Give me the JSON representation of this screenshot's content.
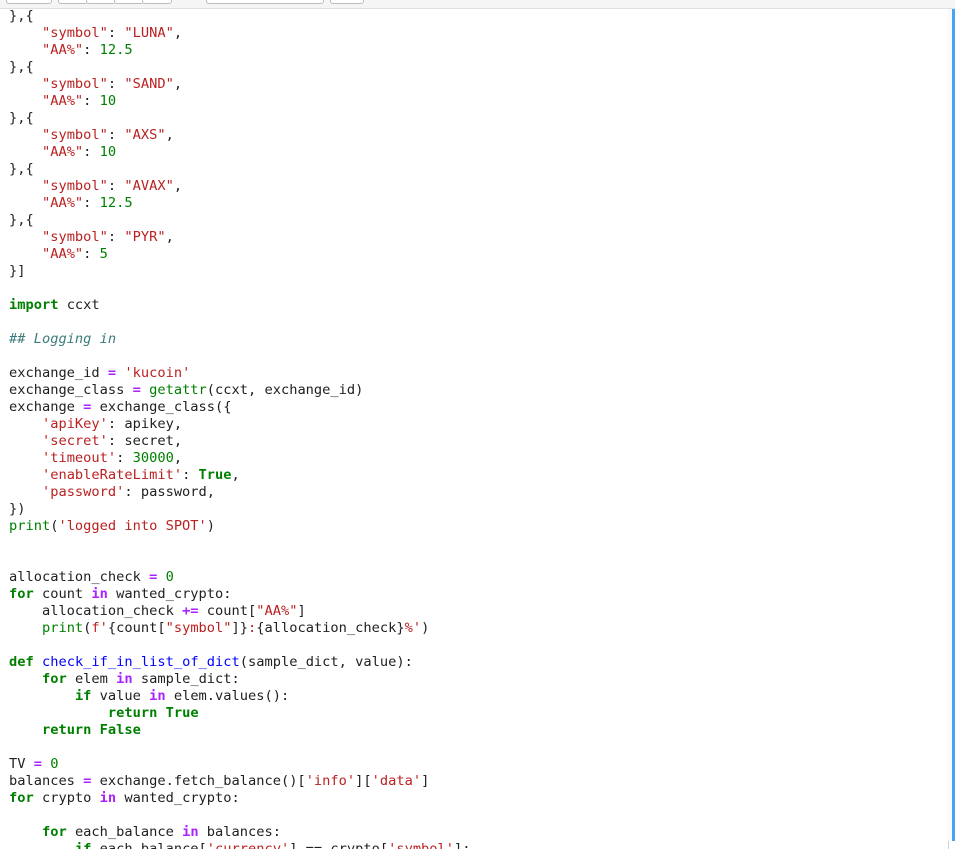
{
  "code_lines": [
    [
      [
        "},{",
        "pl"
      ]
    ],
    [
      [
        "    ",
        "pl"
      ],
      [
        "\"symbol\"",
        "st"
      ],
      [
        ": ",
        "pl"
      ],
      [
        "\"LUNA\"",
        "st"
      ],
      [
        ",",
        "pl"
      ]
    ],
    [
      [
        "    ",
        "pl"
      ],
      [
        "\"AA%\"",
        "st"
      ],
      [
        ": ",
        "pl"
      ],
      [
        "12.5",
        "nu"
      ]
    ],
    [
      [
        "},{",
        "pl"
      ]
    ],
    [
      [
        "    ",
        "pl"
      ],
      [
        "\"symbol\"",
        "st"
      ],
      [
        ": ",
        "pl"
      ],
      [
        "\"SAND\"",
        "st"
      ],
      [
        ",",
        "pl"
      ]
    ],
    [
      [
        "    ",
        "pl"
      ],
      [
        "\"AA%\"",
        "st"
      ],
      [
        ": ",
        "pl"
      ],
      [
        "10",
        "nu"
      ]
    ],
    [
      [
        "},{",
        "pl"
      ]
    ],
    [
      [
        "    ",
        "pl"
      ],
      [
        "\"symbol\"",
        "st"
      ],
      [
        ": ",
        "pl"
      ],
      [
        "\"AXS\"",
        "st"
      ],
      [
        ",",
        "pl"
      ]
    ],
    [
      [
        "    ",
        "pl"
      ],
      [
        "\"AA%\"",
        "st"
      ],
      [
        ": ",
        "pl"
      ],
      [
        "10",
        "nu"
      ]
    ],
    [
      [
        "},{",
        "pl"
      ]
    ],
    [
      [
        "    ",
        "pl"
      ],
      [
        "\"symbol\"",
        "st"
      ],
      [
        ": ",
        "pl"
      ],
      [
        "\"AVAX\"",
        "st"
      ],
      [
        ",",
        "pl"
      ]
    ],
    [
      [
        "    ",
        "pl"
      ],
      [
        "\"AA%\"",
        "st"
      ],
      [
        ": ",
        "pl"
      ],
      [
        "12.5",
        "nu"
      ]
    ],
    [
      [
        "},{",
        "pl"
      ]
    ],
    [
      [
        "    ",
        "pl"
      ],
      [
        "\"symbol\"",
        "st"
      ],
      [
        ": ",
        "pl"
      ],
      [
        "\"PYR\"",
        "st"
      ],
      [
        ",",
        "pl"
      ]
    ],
    [
      [
        "    ",
        "pl"
      ],
      [
        "\"AA%\"",
        "st"
      ],
      [
        ": ",
        "pl"
      ],
      [
        "5",
        "nu"
      ]
    ],
    [
      [
        "}]",
        "pl"
      ]
    ],
    [],
    [
      [
        "import",
        "kw"
      ],
      [
        " ccxt",
        "pl"
      ]
    ],
    [],
    [
      [
        "## Logging in",
        "cm"
      ]
    ],
    [],
    [
      [
        "exchange_id ",
        "pl"
      ],
      [
        "=",
        "op"
      ],
      [
        " ",
        "pl"
      ],
      [
        "'kucoin'",
        "st"
      ]
    ],
    [
      [
        "exchange_class ",
        "pl"
      ],
      [
        "=",
        "op"
      ],
      [
        " ",
        "pl"
      ],
      [
        "getattr",
        "bi"
      ],
      [
        "(ccxt, exchange_id)",
        "pl"
      ]
    ],
    [
      [
        "exchange ",
        "pl"
      ],
      [
        "=",
        "op"
      ],
      [
        " exchange_class({",
        "pl"
      ]
    ],
    [
      [
        "    ",
        "pl"
      ],
      [
        "'apiKey'",
        "st"
      ],
      [
        ": apikey,",
        "pl"
      ]
    ],
    [
      [
        "    ",
        "pl"
      ],
      [
        "'secret'",
        "st"
      ],
      [
        ": secret,",
        "pl"
      ]
    ],
    [
      [
        "    ",
        "pl"
      ],
      [
        "'timeout'",
        "st"
      ],
      [
        ": ",
        "pl"
      ],
      [
        "30000",
        "nu"
      ],
      [
        ",",
        "pl"
      ]
    ],
    [
      [
        "    ",
        "pl"
      ],
      [
        "'enableRateLimit'",
        "st"
      ],
      [
        ": ",
        "pl"
      ],
      [
        "True",
        "kw"
      ],
      [
        ",",
        "pl"
      ]
    ],
    [
      [
        "    ",
        "pl"
      ],
      [
        "'password'",
        "st"
      ],
      [
        ": password,",
        "pl"
      ]
    ],
    [
      [
        "})",
        "pl"
      ]
    ],
    [
      [
        "print",
        "bi"
      ],
      [
        "(",
        "pl"
      ],
      [
        "'logged into SPOT'",
        "st"
      ],
      [
        ")",
        "pl"
      ]
    ],
    [],
    [],
    [
      [
        "allocation_check ",
        "pl"
      ],
      [
        "=",
        "op"
      ],
      [
        " ",
        "pl"
      ],
      [
        "0",
        "nu"
      ]
    ],
    [
      [
        "for",
        "kw"
      ],
      [
        " count ",
        "pl"
      ],
      [
        "in",
        "op"
      ],
      [
        " wanted_crypto:",
        "pl"
      ]
    ],
    [
      [
        "    allocation_check ",
        "pl"
      ],
      [
        "+=",
        "op"
      ],
      [
        " count[",
        "pl"
      ],
      [
        "\"AA%\"",
        "st"
      ],
      [
        "]",
        "pl"
      ]
    ],
    [
      [
        "    ",
        "pl"
      ],
      [
        "print",
        "bi"
      ],
      [
        "(",
        "pl"
      ],
      [
        "f'",
        "st"
      ],
      [
        "{count[",
        "pl"
      ],
      [
        "\"symbol\"",
        "st"
      ],
      [
        "]}",
        "pl"
      ],
      [
        ":",
        "st"
      ],
      [
        "{allocation_check}",
        "pl"
      ],
      [
        "%'",
        "st"
      ],
      [
        ")",
        "pl"
      ]
    ],
    [],
    [
      [
        "def",
        "kw"
      ],
      [
        " ",
        "pl"
      ],
      [
        "check_if_in_list_of_dict",
        "fn"
      ],
      [
        "(sample_dict, value):",
        "pl"
      ]
    ],
    [
      [
        "    ",
        "pl"
      ],
      [
        "for",
        "kw"
      ],
      [
        " elem ",
        "pl"
      ],
      [
        "in",
        "op"
      ],
      [
        " sample_dict:",
        "pl"
      ]
    ],
    [
      [
        "        ",
        "pl"
      ],
      [
        "if",
        "kw"
      ],
      [
        " value ",
        "pl"
      ],
      [
        "in",
        "op"
      ],
      [
        " elem.values():",
        "pl"
      ]
    ],
    [
      [
        "            ",
        "pl"
      ],
      [
        "return",
        "kw"
      ],
      [
        " ",
        "pl"
      ],
      [
        "True",
        "kw"
      ]
    ],
    [
      [
        "    ",
        "pl"
      ],
      [
        "return",
        "kw"
      ],
      [
        " ",
        "pl"
      ],
      [
        "False",
        "kw"
      ]
    ],
    [],
    [
      [
        "TV ",
        "pl"
      ],
      [
        "=",
        "op"
      ],
      [
        " ",
        "pl"
      ],
      [
        "0",
        "nu"
      ]
    ],
    [
      [
        "balances ",
        "pl"
      ],
      [
        "=",
        "op"
      ],
      [
        " exchange.fetch_balance()[",
        "pl"
      ],
      [
        "'info'",
        "st"
      ],
      [
        "][",
        "pl"
      ],
      [
        "'data'",
        "st"
      ],
      [
        "]",
        "pl"
      ]
    ],
    [
      [
        "for",
        "kw"
      ],
      [
        " crypto ",
        "pl"
      ],
      [
        "in",
        "op"
      ],
      [
        " wanted_crypto:",
        "pl"
      ]
    ],
    [],
    [
      [
        "    ",
        "pl"
      ],
      [
        "for",
        "kw"
      ],
      [
        " each_balance ",
        "pl"
      ],
      [
        "in",
        "op"
      ],
      [
        " balances:",
        "pl"
      ]
    ],
    [
      [
        "        ",
        "pl"
      ],
      [
        "if",
        "kw"
      ],
      [
        " each_balance[",
        "pl"
      ],
      [
        "'currency'",
        "st"
      ],
      [
        "] == crypto[",
        "pl"
      ],
      [
        "'symbol'",
        "st"
      ],
      [
        "]:",
        "pl"
      ]
    ]
  ],
  "colors": {
    "keyword": "#008000",
    "operator": "#aa22ff",
    "string": "#ba2121",
    "number": "#008000",
    "function_name": "#0000ff",
    "builtin": "#008000",
    "comment": "#3d7b7b",
    "plain": "#212121",
    "cell_selection": "#42a5f5"
  }
}
